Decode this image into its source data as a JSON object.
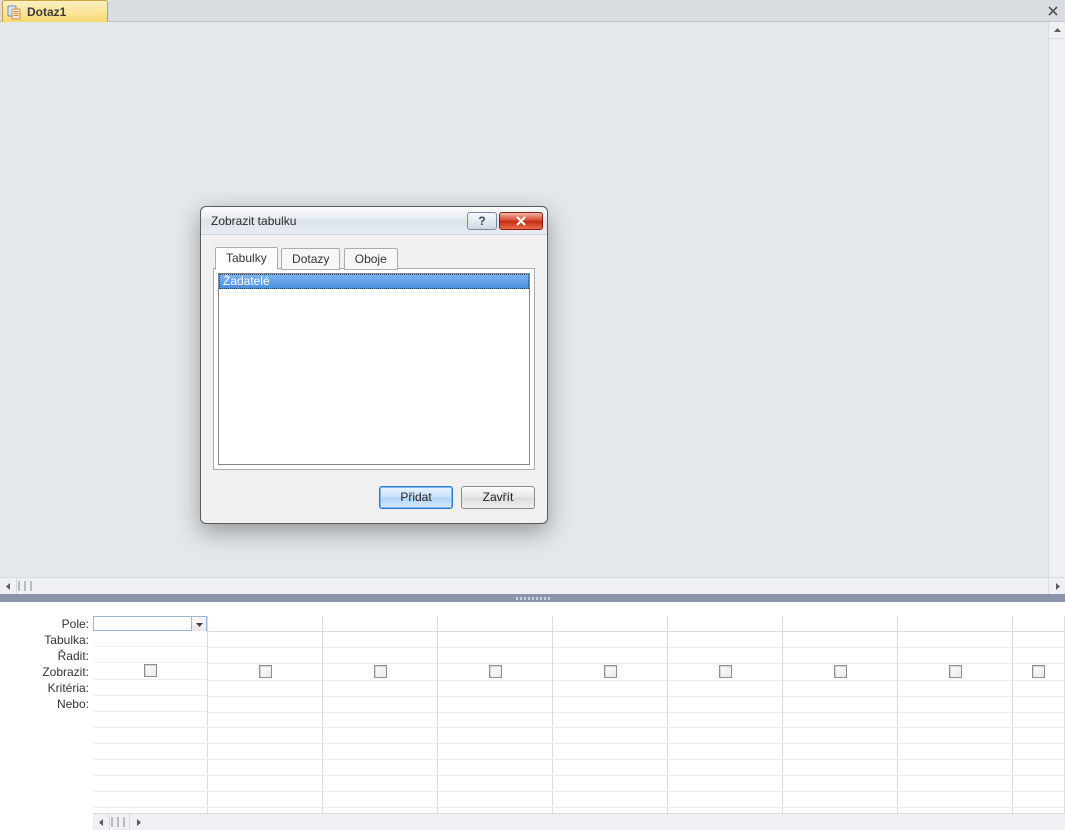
{
  "document": {
    "tab_title": "Dotaz1"
  },
  "query_grid": {
    "labels": {
      "field": "Pole:",
      "table": "Tabulka:",
      "sort": "Řadit:",
      "show": "Zobrazit:",
      "criteria": "Kritéria:",
      "or": "Nebo:"
    },
    "column_count": 9
  },
  "dialog": {
    "title": "Zobrazit tabulku",
    "tabs": {
      "tables": "Tabulky",
      "queries": "Dotazy",
      "both": "Oboje",
      "active": "tables"
    },
    "items": [
      "Žadatelé"
    ],
    "buttons": {
      "add": "Přidat",
      "close": "Zavřít"
    }
  }
}
